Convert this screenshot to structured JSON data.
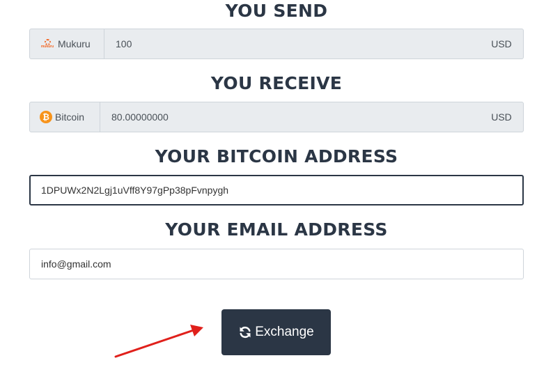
{
  "send": {
    "heading": "YOU SEND",
    "provider_label": "Mukuru",
    "provider_logo_text": "mukuru",
    "provider_icon": "mukuru-logo-icon",
    "amount": "100",
    "currency": "USD"
  },
  "receive": {
    "heading": "YOU RECEIVE",
    "provider_label": "Bitcoin",
    "provider_icon": "bitcoin-icon",
    "amount": "80.00000000",
    "currency": "USD"
  },
  "address": {
    "heading": "YOUR BITCOIN ADDRESS",
    "value": "1DPUWx2N2Lgj1uVff8Y97gPp38pFvnpygh"
  },
  "email": {
    "heading": "YOUR EMAIL ADDRESS",
    "value": "info@gmail.com"
  },
  "button": {
    "label": "Exchange",
    "icon": "refresh-icon"
  },
  "colors": {
    "heading": "#2b3645",
    "button_bg": "#2b3645",
    "addon_bg": "#e9ecef",
    "bitcoin": "#f7931a",
    "mukuru": "#f26522",
    "annotation_arrow": "#e0201b"
  }
}
